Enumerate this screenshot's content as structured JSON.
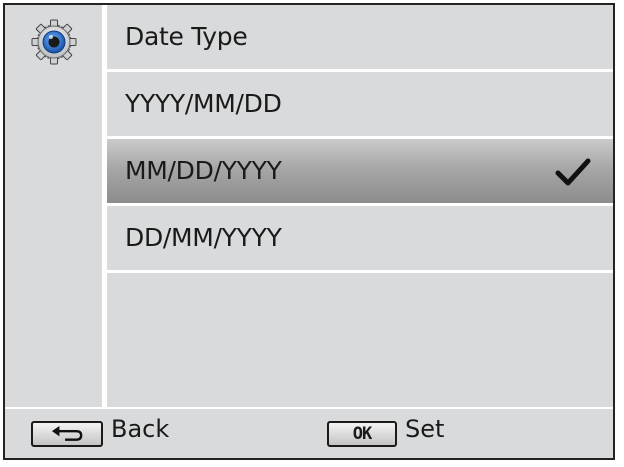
{
  "menu": {
    "title": "Date Type",
    "options": [
      {
        "label": "YYYY/MM/DD",
        "selected": false
      },
      {
        "label": "MM/DD/YYYY",
        "selected": true
      },
      {
        "label": "DD/MM/YYYY",
        "selected": false
      }
    ]
  },
  "sidebar": {
    "icon": "settings-gear-icon"
  },
  "footer": {
    "back_label": "Back",
    "set_label": "Set",
    "ok_key": "OK",
    "back_icon": "return-arrow-icon"
  },
  "colors": {
    "background": "#d9dadb",
    "divider": "#ffffff",
    "selected_top": "#cbcbcb",
    "selected_bottom": "#8c8c8c",
    "gear_blue": "#1e6fd0"
  }
}
